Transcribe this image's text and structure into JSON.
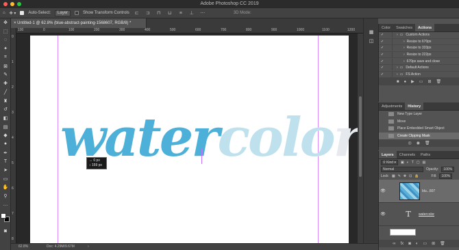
{
  "app": {
    "title": "Adobe Photoshop CC 2019"
  },
  "window_controls": {
    "close_color": "#ff5f57",
    "minimize_color": "#febc2e",
    "zoom_color": "#28c840"
  },
  "options_bar": {
    "auto_select_label": "Auto-Select:",
    "auto_select_value": "Layer",
    "transform_label": "Show Transform Controls",
    "three_d_label": "3D Mode:"
  },
  "document": {
    "tab_label": "Untitled-1 @ 62.8% (blue-abstract-painting-1568607, RGB/8) *",
    "zoom": "62.8%",
    "doc_info": "Doc: 4.29M/9.67M",
    "ruler_ticks": [
      "100",
      "0",
      "100",
      "200",
      "300",
      "400",
      "500",
      "600",
      "700",
      "800",
      "900",
      "1000",
      "1100",
      "1200"
    ],
    "vruler_ticks": [
      "0",
      "1",
      "2",
      "3",
      "4",
      "5",
      "6",
      "7",
      "8"
    ]
  },
  "canvas": {
    "word_a": "water",
    "word_b": "colo",
    "word_c": "r",
    "tooltip_x": "0 px",
    "tooltip_y": "159 px",
    "accent_color": "#4cb0d8"
  },
  "actions_panel": {
    "tabs": [
      "Color",
      "Swatches",
      "Actions"
    ],
    "items": [
      {
        "label": "Custom Actions",
        "checked": true,
        "indent": 1
      },
      {
        "label": "Resize to 670px",
        "checked": true,
        "indent": 2
      },
      {
        "label": "Resize to 333px",
        "checked": true,
        "indent": 2
      },
      {
        "label": "Resize to 222px",
        "checked": true,
        "indent": 2
      },
      {
        "label": "670px save and close",
        "checked": true,
        "indent": 2
      },
      {
        "label": "Default Actions",
        "checked": true,
        "indent": 1
      },
      {
        "label": "FS Action",
        "checked": true,
        "indent": 1
      }
    ]
  },
  "history_panel": {
    "tabs": [
      "Adjustments",
      "History"
    ],
    "items": [
      "New Type Layer",
      "Move",
      "Place Embedded Smart Object",
      "Create Clipping Mask"
    ],
    "selected_index": 3
  },
  "layers_panel": {
    "tabs": [
      "Layers",
      "Channels",
      "Paths"
    ],
    "filter": "Kind",
    "blend_mode": "Normal",
    "opacity_label": "Opacity:",
    "opacity_value": "100%",
    "lock_label": "Lock:",
    "fill_label": "Fill:",
    "fill_value": "100%",
    "layers": [
      {
        "name": "blu...607",
        "type": "image"
      },
      {
        "name": "watercolor",
        "type": "text"
      }
    ]
  }
}
